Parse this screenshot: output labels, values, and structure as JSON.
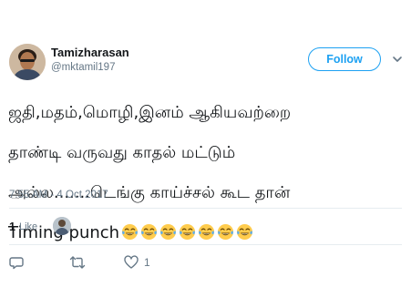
{
  "author": {
    "display_name": "Tamizharasan",
    "handle": "@mktamil197"
  },
  "follow_button": {
    "label": "Follow"
  },
  "tweet": {
    "lines": [
      "ஜதி,மதம்,மொழி,இனம் ஆகியவற்றை",
      "தாண்டி வருவது காதல் மட்டும்",
      "அல்ல.......டெங்கு காய்ச்சல் கூட தான்",
      "Timing punch"
    ],
    "emoji_name": "face-with-tears-of-joy",
    "emoji_count": 7,
    "timestamp": "7:55 AM - 4 Oct 2017"
  },
  "stats": {
    "likes_count": "1",
    "likes_label": "Like"
  },
  "actions": {
    "reply_count": "",
    "retweet_count": "",
    "like_count": "1"
  },
  "colors": {
    "accent": "#1da1f2",
    "secondary_text": "#657786",
    "divider": "#e6ecf0"
  }
}
